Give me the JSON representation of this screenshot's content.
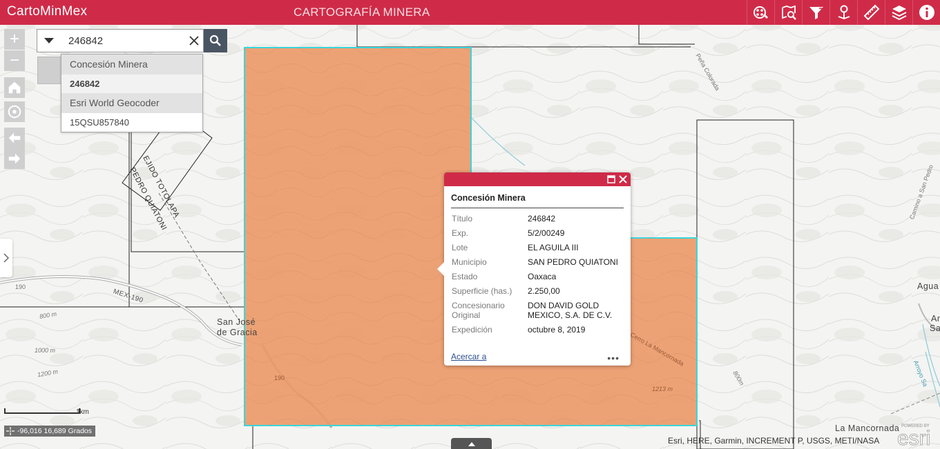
{
  "header": {
    "app_title": "CartoMinMex",
    "subtitle": "CARTOGRAFÍA MINERA",
    "tools": [
      "analysis-icon",
      "query-icon",
      "filter-icon",
      "location-icon",
      "measure-icon",
      "layers-icon",
      "info-icon"
    ]
  },
  "search": {
    "value": "246842",
    "suggestions": [
      {
        "source": "Concesión Minera",
        "result": "246842"
      },
      {
        "source": "Esri World Geocoder",
        "result": "15QSU857840"
      }
    ]
  },
  "nav": {
    "zoom_in": "+",
    "zoom_out": "−"
  },
  "popup": {
    "title": "Concesión Minera",
    "fields": [
      {
        "label": "Título",
        "value": "246842"
      },
      {
        "label": "Exp.",
        "value": "5/2/00249"
      },
      {
        "label": "Lote",
        "value": "EL AGUILA III"
      },
      {
        "label": "Municipio",
        "value": "SAN PEDRO QUIATONI"
      },
      {
        "label": "Estado",
        "value": "Oaxaca"
      },
      {
        "label": "Superficie (has.)",
        "value": "2.250,00"
      },
      {
        "label": "Concesionario Original",
        "value": "DON DAVID GOLD MEXICO, S.A. DE C.V."
      },
      {
        "label": "Expedición",
        "value": "octubre 8, 2019"
      }
    ],
    "zoom_link": "Acercar a",
    "more": "•••"
  },
  "map": {
    "concession_fill": "#eb9a6a",
    "concession_outline": "#38d6dc",
    "labels": {
      "san_jose": "San José\nde Gracia",
      "la_mancornada": "La Mancornada",
      "agua": "Agua",
      "ar": "Ar",
      "sa": "Sa",
      "mex190": "MEX-190",
      "r190a": "190",
      "r190b": "190",
      "quiatoni": "PEDRO QUIATONI",
      "totolapa": "EJIDO TOTOLAPA",
      "pena_colorada": "Peña Colorada",
      "camino_san_pedro": "Camino a San Pedro",
      "arroyo": "Arroyo Sa",
      "cerro_mancornada": "Cerro La Mancornada",
      "c800a": "800 m",
      "c1000": "1000 m",
      "c1200": "1200 m",
      "c1213": "1213 m",
      "c800b": "800m"
    }
  },
  "scale": {
    "label": "1km"
  },
  "coordinates": "-96,016 16,689 Grados",
  "attribution": "Esri, HERE, Garmin, INCREMENT P, USGS, METI/NASA",
  "esri_logo": {
    "powered": "POWERED BY",
    "brand": "esri"
  }
}
